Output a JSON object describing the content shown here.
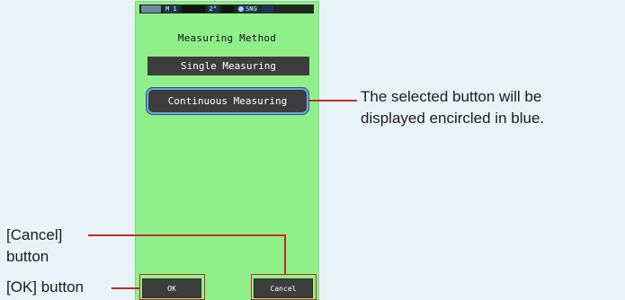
{
  "screen": {
    "status_bar": {
      "mode": "M 1",
      "angle": "2°",
      "measure": "SNG"
    },
    "title": "Measuring Method",
    "buttons": {
      "single": "Single Measuring",
      "continuous": "Continuous Measuring",
      "ok": "OK",
      "cancel": "Cancel"
    }
  },
  "annotations": {
    "selected_line1": "The selected button will be",
    "selected_line2": "displayed encircled in blue.",
    "cancel_line1": "[Cancel]",
    "cancel_line2": "button",
    "ok": "[OK] button"
  },
  "colors": {
    "screen_bg": "#8ff08a",
    "button_bg": "#3d3d3d",
    "selected_ring": "#6fa6df",
    "highlight": "#c62828",
    "page_bg": "#e7f3f7"
  }
}
